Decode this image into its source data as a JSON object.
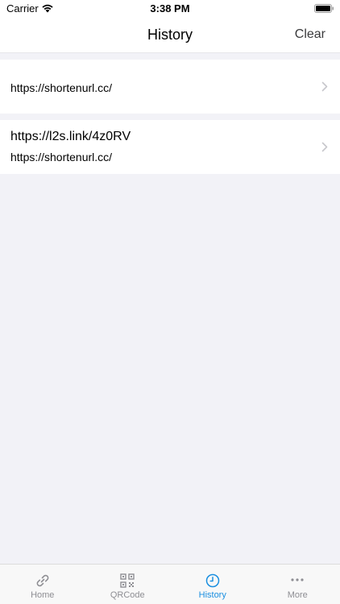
{
  "status_bar": {
    "carrier": "Carrier",
    "time": "3:38 PM"
  },
  "nav": {
    "title": "History",
    "clear_label": "Clear"
  },
  "history": [
    {
      "short_url": "",
      "long_url": "https://shortenurl.cc/"
    },
    {
      "short_url": "https://l2s.link/4z0RV",
      "long_url": "https://shortenurl.cc/"
    }
  ],
  "tabs": [
    {
      "label": "Home",
      "icon": "link-icon",
      "active": false
    },
    {
      "label": "QRCode",
      "icon": "qrcode-icon",
      "active": false
    },
    {
      "label": "History",
      "icon": "clock-icon",
      "active": true
    },
    {
      "label": "More",
      "icon": "more-icon",
      "active": false
    }
  ],
  "colors": {
    "accent": "#1a8fe0",
    "inactive": "#8e8e93",
    "background": "#f2f2f7"
  }
}
